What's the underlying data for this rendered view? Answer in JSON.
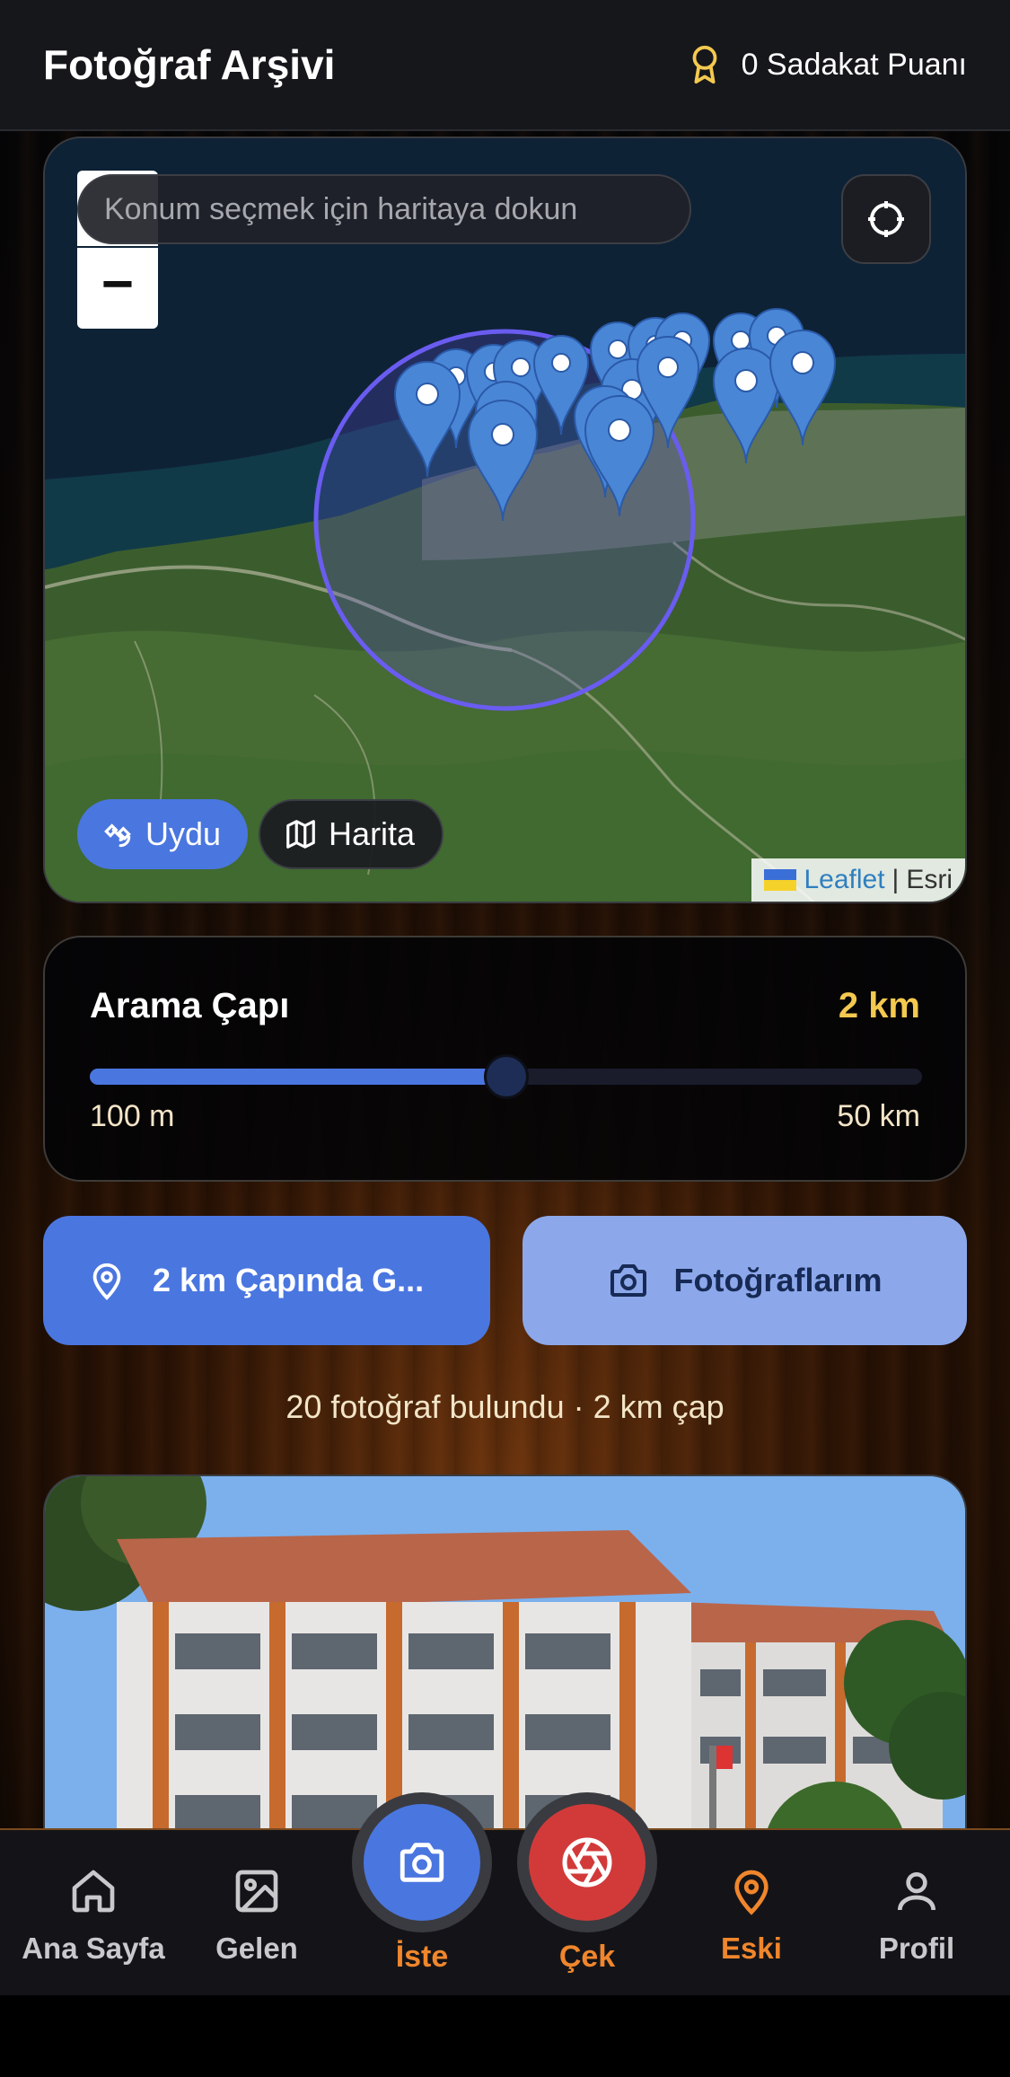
{
  "header": {
    "title": "Fotoğraf Arşivi",
    "loyalty_label": "0 Sadakat Puanı"
  },
  "map": {
    "search_placeholder": "Konum seçmek için haritaya dokun",
    "zoom_out_label": "−",
    "layer_satellite_label": "Uydu",
    "layer_map_label": "Harita",
    "active_layer": "satellite",
    "attribution_leaflet": "Leaflet",
    "attribution_separator": "|",
    "attribution_provider": "Esri",
    "marker_icon": "map-pin-icon",
    "radius_circle_color": "#6a5cf0"
  },
  "radius": {
    "title": "Arama Çapı",
    "value_label": "2 km",
    "min_label": "100 m",
    "max_label": "50 km",
    "slider_fraction": 0.5
  },
  "actions": {
    "search_button": "2 km Çapında G...",
    "photos_button": "Fotoğraflarım"
  },
  "results": {
    "summary": "20 fotoğraf bulundu · 2 km çap"
  },
  "nav": {
    "home": "Ana Sayfa",
    "incoming": "Gelen",
    "request": "İste",
    "capture": "Çek",
    "old": "Eski",
    "profile": "Profil",
    "active": "old"
  },
  "colors": {
    "accent_blue": "#4a76e0",
    "accent_orange": "#f0862c",
    "accent_gold": "#f4c94f",
    "capture_red": "#d23a3a"
  }
}
